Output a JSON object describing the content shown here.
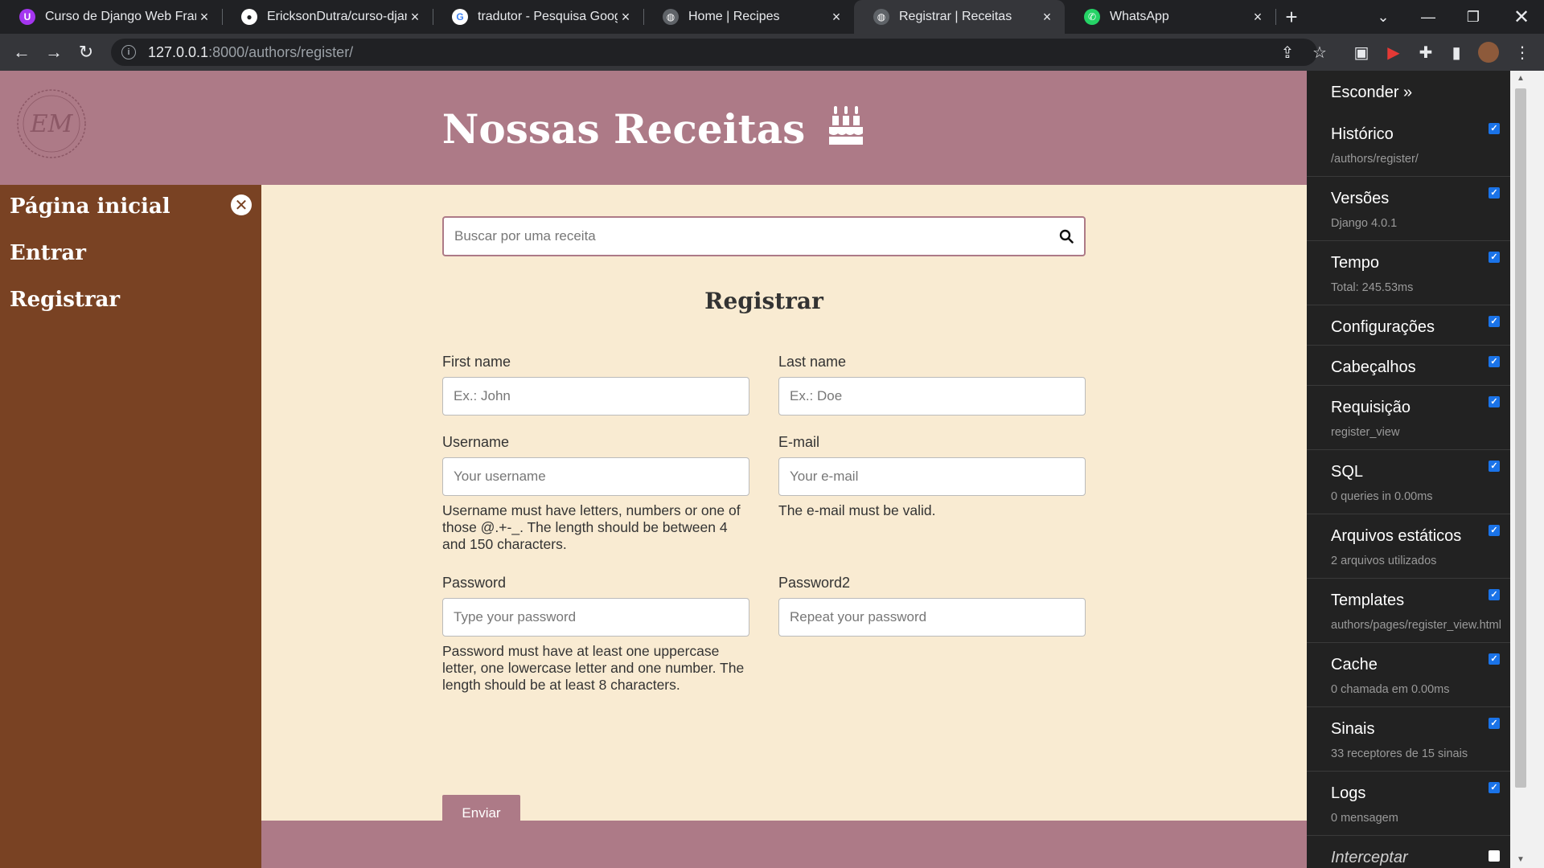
{
  "browser": {
    "tabs": [
      {
        "title": "Curso de Django Web Fram",
        "icon": "udemy-icon",
        "color": "#a435f0"
      },
      {
        "title": "EricksonDutra/curso-djang",
        "icon": "github-icon",
        "color": "#ffffff"
      },
      {
        "title": "tradutor - Pesquisa Google",
        "icon": "google-icon",
        "color": "#ffffff"
      },
      {
        "title": "Home | Recipes",
        "icon": "globe-icon",
        "color": "#9aa0a6"
      },
      {
        "title": "Registrar | Receitas",
        "icon": "globe-icon",
        "color": "#9aa0a6",
        "active": true
      },
      {
        "title": "WhatsApp",
        "icon": "whatsapp-icon",
        "color": "#25d366"
      }
    ],
    "new_tab": "+",
    "url_host": "127.0.0.1",
    "url_rest": ":8000/authors/register/"
  },
  "site": {
    "title": "Nossas Receitas",
    "logo_text": "EM",
    "colors": {
      "header": "#ad7a87",
      "sidebar": "#794223",
      "background": "#f9ebd2"
    }
  },
  "sidebar": {
    "items": [
      {
        "label": "Página inicial"
      },
      {
        "label": "Entrar"
      },
      {
        "label": "Registrar"
      }
    ]
  },
  "search": {
    "placeholder": "Buscar por uma receita"
  },
  "form": {
    "title": "Registrar",
    "first_name": {
      "label": "First name",
      "placeholder": "Ex.: John"
    },
    "last_name": {
      "label": "Last name",
      "placeholder": "Ex.: Doe"
    },
    "username": {
      "label": "Username",
      "placeholder": "Your username",
      "help": "Username must have letters, numbers or one of those @.+-_. The length should be between 4 and 150 characters."
    },
    "email": {
      "label": "E-mail",
      "placeholder": "Your e-mail",
      "help": "The e-mail must be valid."
    },
    "password": {
      "label": "Password",
      "placeholder": "Type your password",
      "help": "Password must have at least one uppercase letter, one lowercase letter and one number. The length should be at least 8 characters."
    },
    "password2": {
      "label": "Password2",
      "placeholder": "Repeat your password"
    },
    "submit": "Enviar"
  },
  "debug_toolbar": {
    "hide": "Esconder »",
    "panels": [
      {
        "title": "Histórico",
        "sub": "/authors/register/",
        "checked": true
      },
      {
        "title": "Versões",
        "sub": "Django 4.0.1",
        "checked": true
      },
      {
        "title": "Tempo",
        "sub": "Total: 245.53ms",
        "checked": true
      },
      {
        "title": "Configurações",
        "sub": "",
        "checked": true
      },
      {
        "title": "Cabeçalhos",
        "sub": "",
        "checked": true
      },
      {
        "title": "Requisição",
        "sub": "register_view",
        "checked": true
      },
      {
        "title": "SQL",
        "sub": "0 queries in 0.00ms",
        "checked": true
      },
      {
        "title": "Arquivos estáticos",
        "sub": "2 arquivos utilizados",
        "checked": true
      },
      {
        "title": "Templates",
        "sub": "authors/pages/register_view.html",
        "checked": true
      },
      {
        "title": "Cache",
        "sub": "0 chamada em 0.00ms",
        "checked": true
      },
      {
        "title": "Sinais",
        "sub": "33 receptores de 15 sinais",
        "checked": true
      },
      {
        "title": "Logs",
        "sub": "0 mensagem",
        "checked": true
      },
      {
        "title": "Interceptar",
        "sub": "",
        "checked": false
      }
    ]
  }
}
